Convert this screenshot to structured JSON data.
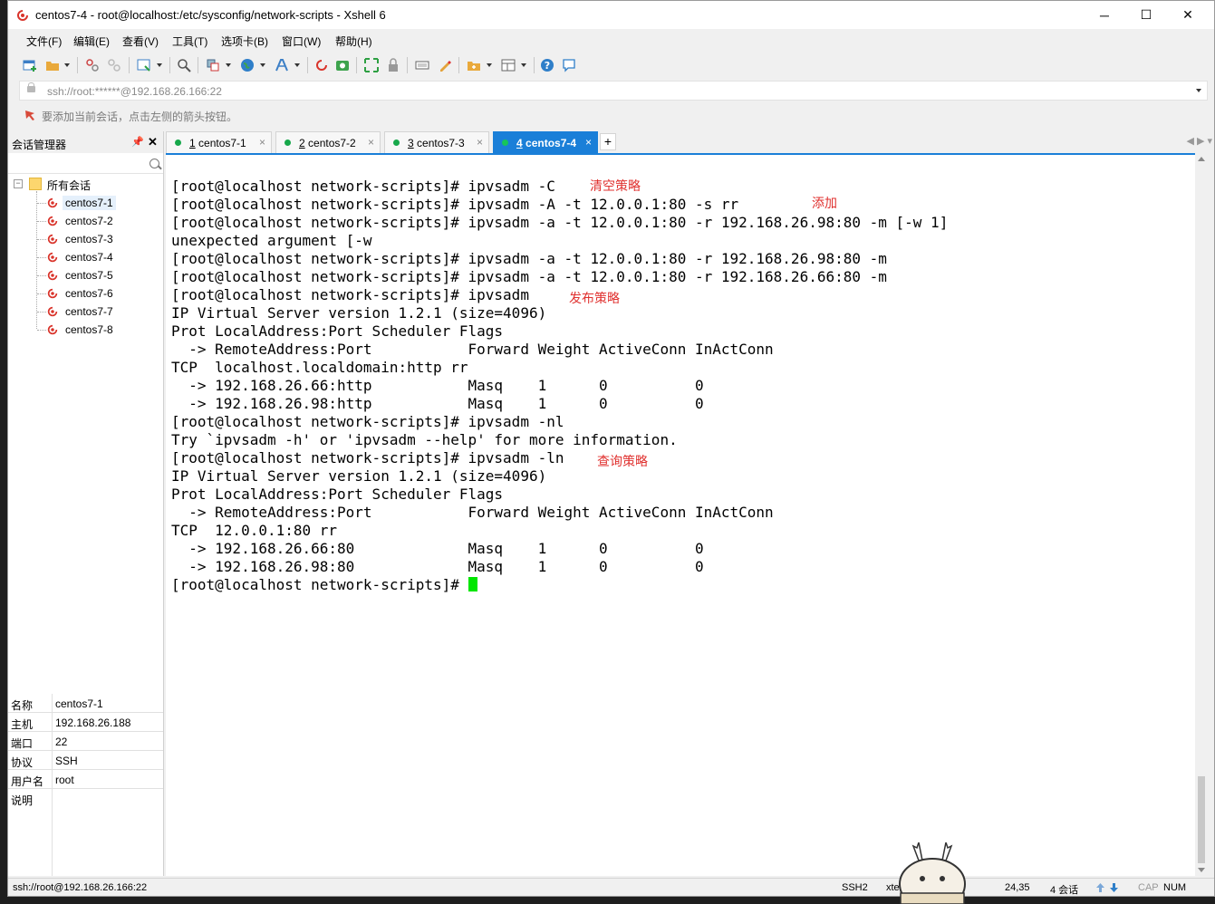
{
  "window": {
    "title": "centos7-4 - root@localhost:/etc/sysconfig/network-scripts - Xshell 6",
    "minimize_glyph": "─",
    "maximize_glyph": "☐",
    "close_glyph": "✕"
  },
  "menu": [
    "文件(F)",
    "编辑(E)",
    "查看(V)",
    "工具(T)",
    "选项卡(B)",
    "窗口(W)",
    "帮助(H)"
  ],
  "address": {
    "value": "ssh://root:******@192.168.26.166:22"
  },
  "hint": "要添加当前会话，点击左侧的箭头按钮。",
  "session_manager": {
    "title": "会话管理器",
    "pin_glyph": "📌",
    "close_glyph": "✕",
    "root_label": "所有会话",
    "toggle_glyph": "−",
    "items": [
      {
        "label": "centos7-1",
        "selected": true
      },
      {
        "label": "centos7-2"
      },
      {
        "label": "centos7-3"
      },
      {
        "label": "centos7-4"
      },
      {
        "label": "centos7-5"
      },
      {
        "label": "centos7-6"
      },
      {
        "label": "centos7-7"
      },
      {
        "label": "centos7-8"
      }
    ]
  },
  "properties": [
    {
      "key": "名称",
      "value": "centos7-1"
    },
    {
      "key": "主机",
      "value": "192.168.26.188"
    },
    {
      "key": "端口",
      "value": "22"
    },
    {
      "key": "协议",
      "value": "SSH"
    },
    {
      "key": "用户名",
      "value": "root"
    },
    {
      "key": "说明",
      "value": ""
    }
  ],
  "tabs": [
    {
      "num": "1",
      "label": " centos7-1",
      "active": false
    },
    {
      "num": "2",
      "label": " centos7-2",
      "active": false
    },
    {
      "num": "3",
      "label": " centos7-3",
      "active": false
    },
    {
      "num": "4",
      "label": " centos7-4",
      "active": true
    }
  ],
  "tab_close_glyph": "×",
  "add_tab_glyph": "+",
  "tab_nav": "◀ ▶  ▾",
  "terminal": {
    "lines": [
      "[root@localhost network-scripts]# ipvsadm -C",
      "[root@localhost network-scripts]# ipvsadm -A -t 12.0.0.1:80 -s rr",
      "[root@localhost network-scripts]# ipvsadm -a -t 12.0.0.1:80 -r 192.168.26.98:80 -m [-w 1]",
      "unexpected argument [-w",
      "[root@localhost network-scripts]# ipvsadm -a -t 12.0.0.1:80 -r 192.168.26.98:80 -m",
      "[root@localhost network-scripts]# ipvsadm -a -t 12.0.0.1:80 -r 192.168.26.66:80 -m",
      "[root@localhost network-scripts]# ipvsadm",
      "IP Virtual Server version 1.2.1 (size=4096)",
      "Prot LocalAddress:Port Scheduler Flags",
      "  -> RemoteAddress:Port           Forward Weight ActiveConn InActConn",
      "TCP  localhost.localdomain:http rr",
      "  -> 192.168.26.66:http           Masq    1      0          0",
      "  -> 192.168.26.98:http           Masq    1      0          0",
      "[root@localhost network-scripts]# ipvsadm -nl",
      "Try `ipvsadm -h' or 'ipvsadm --help' for more information.",
      "[root@localhost network-scripts]# ipvsadm -ln",
      "IP Virtual Server version 1.2.1 (size=4096)",
      "Prot LocalAddress:Port Scheduler Flags",
      "  -> RemoteAddress:Port           Forward Weight ActiveConn InActConn",
      "TCP  12.0.0.1:80 rr",
      "  -> 192.168.26.66:80             Masq    1      0          0",
      "  -> 192.168.26.98:80             Masq    1      0          0",
      "[root@localhost network-scripts]# "
    ],
    "annotations": [
      "清空策略",
      "添加",
      "发布策略",
      "查询策略"
    ],
    "cursor_color": "#00e600"
  },
  "status": {
    "connection": "ssh://root@192.168.26.166:22",
    "protocol": "SSH2",
    "terminal": "xter",
    "cursor_pos": "24,35",
    "sessions": "4 会话",
    "cap": "CAP",
    "num": "NUM"
  },
  "colors": {
    "accent": "#1a7fd8",
    "annotation": "#e0312f",
    "session_dot": "#17a84b"
  }
}
